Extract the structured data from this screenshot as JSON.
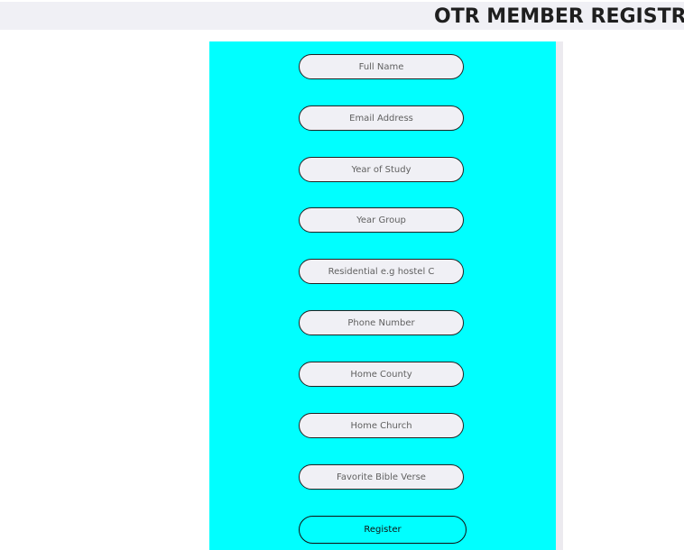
{
  "header": {
    "title": "OTR MEMBER REGISTR"
  },
  "form": {
    "fields": [
      {
        "placeholder": "Full Name"
      },
      {
        "placeholder": "Email Address"
      },
      {
        "placeholder": "Year of Study"
      },
      {
        "placeholder": "Year Group"
      },
      {
        "placeholder": "Residential e.g hostel C"
      },
      {
        "placeholder": "Phone Number"
      },
      {
        "placeholder": "Home County"
      },
      {
        "placeholder": "Home Church"
      },
      {
        "placeholder": "Favorite Bible Verse"
      }
    ],
    "submit_label": "Register"
  },
  "colors": {
    "panel_background": "#00ffff",
    "field_background": "#f0f0f5",
    "header_background": "#f0f0f5"
  }
}
